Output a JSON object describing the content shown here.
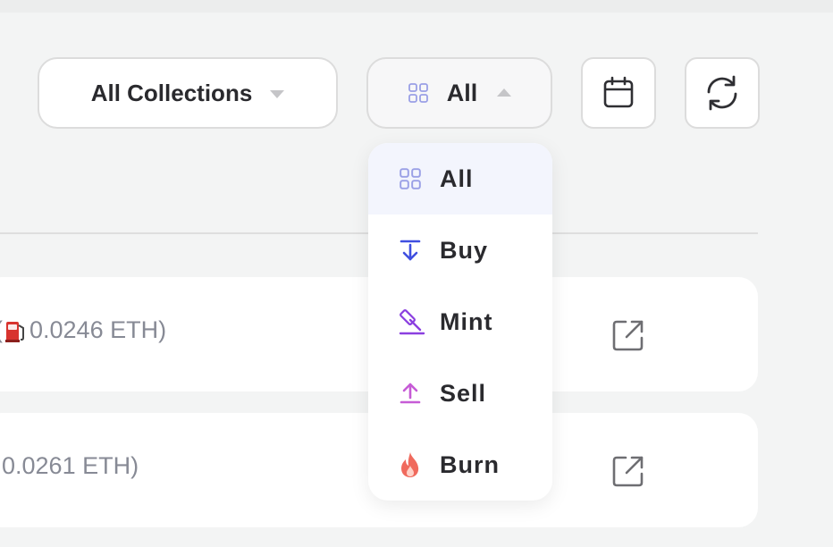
{
  "filters": {
    "collections_label": "All Collections",
    "type_label": "All"
  },
  "type_menu": {
    "items": [
      {
        "label": "All",
        "icon": "grid-icon",
        "color": "#9aa0e6"
      },
      {
        "label": "Buy",
        "icon": "download-arrow-icon",
        "color": "#3f4fe0"
      },
      {
        "label": "Mint",
        "icon": "gavel-icon",
        "color": "#8b3fe0"
      },
      {
        "label": "Sell",
        "icon": "upload-arrow-icon",
        "color": "#c65bd6"
      },
      {
        "label": "Burn",
        "icon": "flame-icon",
        "color": "#f06a5d"
      }
    ],
    "selected": "All"
  },
  "rows": [
    {
      "fee_text": "0.0246 ETH)",
      "prefix": "("
    },
    {
      "fee_text": "0.0261 ETH)",
      "prefix": ""
    }
  ]
}
